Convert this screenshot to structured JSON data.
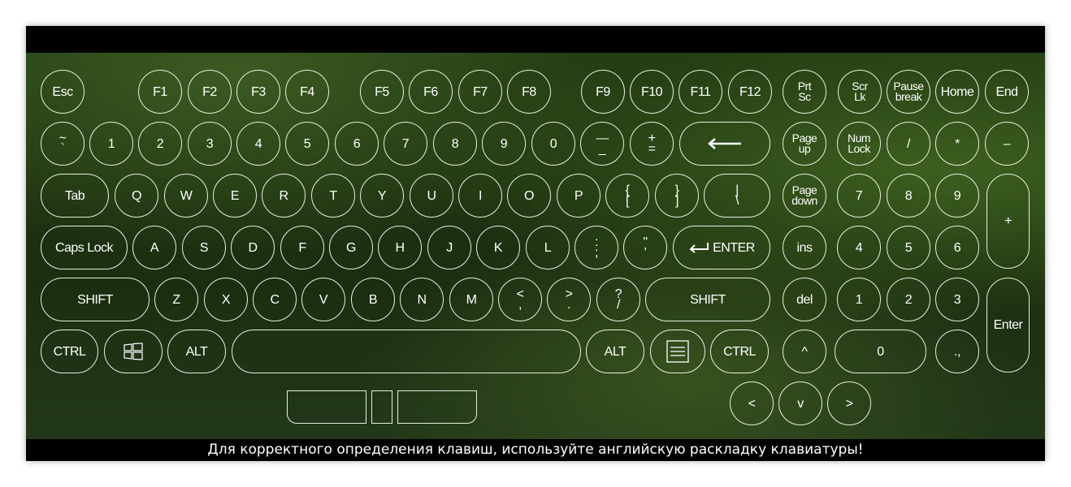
{
  "footer": "Для корректного определения клавиш, используйте английскую раскладку клавиатуры!",
  "colors": {
    "background": "#223a12",
    "key_outline": "#e8eee0",
    "bar": "#000000"
  },
  "icons": {
    "windows": "windows-logo-icon",
    "menu": "context-menu-icon",
    "backspace": "arrow-left-icon",
    "enter": "return-arrow-icon"
  },
  "keys": [
    "Esc",
    "F1",
    "F2",
    "F3",
    "F4",
    "F5",
    "F6",
    "F7",
    "F8",
    "F9",
    "F10",
    "F11",
    "F12",
    "Prt\nSc",
    "Scr\nLk",
    "Pause\nbreak",
    "Home",
    "End",
    "~\n`",
    "1",
    "2",
    "3",
    "4",
    "5",
    "6",
    "7",
    "8",
    "9",
    "0",
    "—\n_",
    "+\n=",
    "",
    "Page\nup",
    "Num\nLock",
    "/",
    "*",
    "–",
    "Tab",
    "Q",
    "W",
    "E",
    "R",
    "T",
    "Y",
    "U",
    "I",
    "O",
    "P",
    "{\n[",
    "}\n]",
    "|\n\\",
    "Page\ndown",
    "7",
    "8",
    "9",
    "+",
    "Caps Lock",
    "A",
    "S",
    "D",
    "F",
    "G",
    "H",
    "J",
    "K",
    "L",
    ":\n;",
    "\"\n'",
    "ENTER",
    "ins",
    "4",
    "5",
    "6",
    "SHIFT",
    "Z",
    "X",
    "C",
    "V",
    "B",
    "N",
    "M",
    "<\n,",
    ">\n.",
    "?\n/",
    "SHIFT",
    "del",
    "1",
    "2",
    "3",
    "Enter",
    "CTRL",
    "",
    "ALT",
    "",
    "ALT",
    "",
    "CTRL",
    "^",
    "0",
    ".,",
    "<",
    "v",
    ">",
    "",
    "",
    ""
  ]
}
